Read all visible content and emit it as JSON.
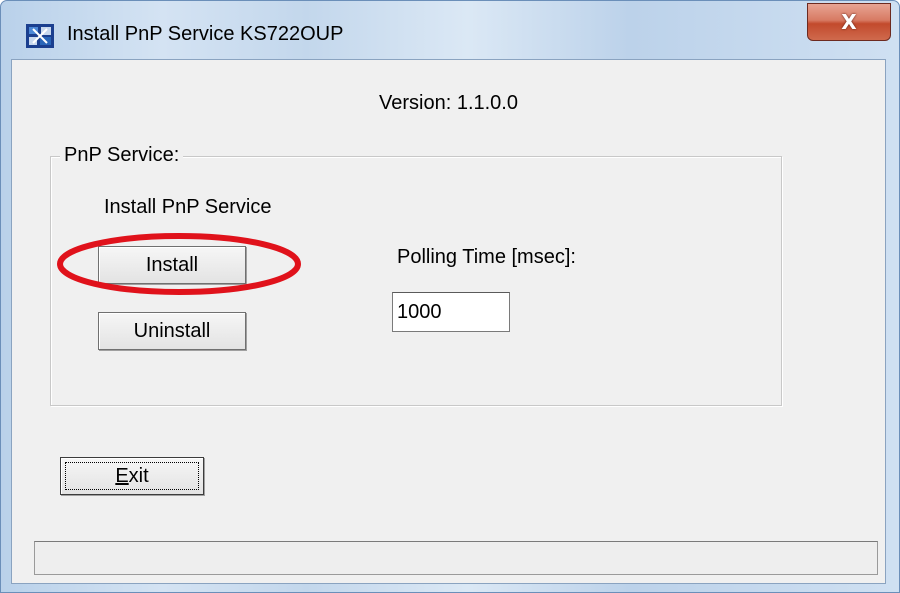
{
  "window": {
    "title": "Install PnP Service KS722OUP",
    "close_glyph": "X",
    "app_icon": "app-puzzle-icon"
  },
  "version_text": "Version: 1.1.0.0",
  "pnp_group": {
    "label": "PnP Service:",
    "install_heading": "Install PnP Service",
    "install_label": "Install",
    "uninstall_label": "Uninstall",
    "polling_label": "Polling Time [msec]:",
    "polling_value": "1000"
  },
  "exit_button": {
    "mnemonic": "E",
    "rest": "xit"
  },
  "status_text": "",
  "colors": {
    "highlight_ring": "#e0121b",
    "dialog_bg": "#f0f0f0"
  }
}
